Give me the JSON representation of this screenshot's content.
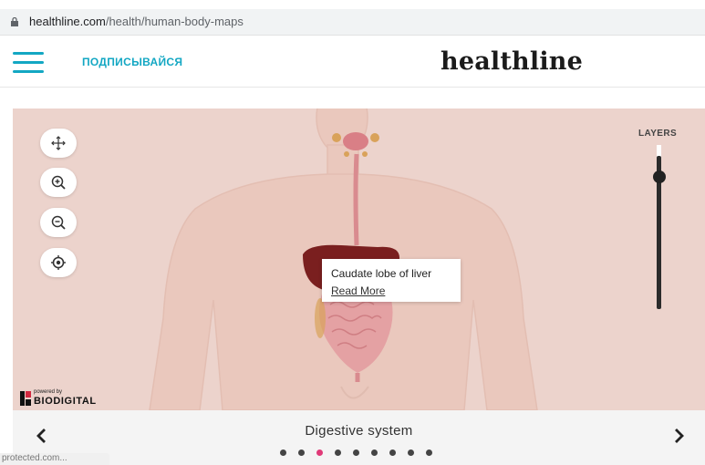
{
  "browser": {
    "url_domain": "healthline.com",
    "url_path": "/health/human-body-maps"
  },
  "header": {
    "subscribe_label": "ПОДПИСЫВАЙСЯ",
    "logo_text": "healthline"
  },
  "viewer": {
    "controls": [
      {
        "icon": "move-icon"
      },
      {
        "icon": "zoom-in-icon"
      },
      {
        "icon": "zoom-out-icon"
      },
      {
        "icon": "center-target-icon"
      }
    ],
    "layers_label": "LAYERS",
    "layers_level": 0.92,
    "tooltip": {
      "title": "Caudate lobe of liver",
      "link": "Read More"
    },
    "powered_by": "powered by",
    "brand": "BIODIGITAL"
  },
  "carousel": {
    "title": "Digestive system",
    "prev_icon": "chevron-left-icon",
    "next_icon": "chevron-right-icon",
    "dot_count": 9,
    "active_index": 2
  },
  "status_bar": "protected.com...",
  "colors": {
    "accent": "#13a7c3",
    "viewer_bg": "#ecd3cc",
    "active_dot": "#e03a78"
  }
}
